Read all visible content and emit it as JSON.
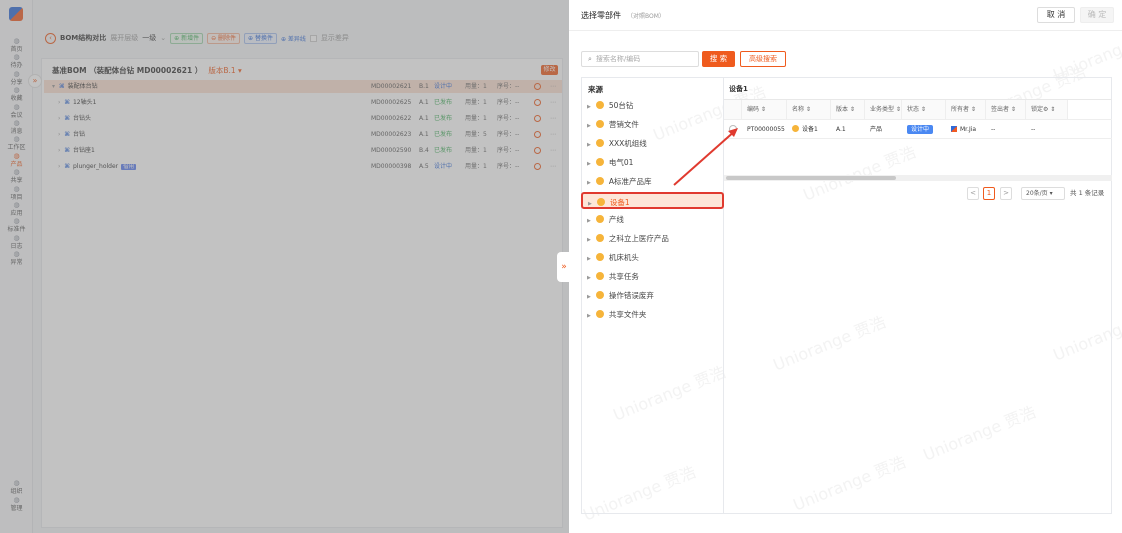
{
  "rail": {
    "items": [
      {
        "icon": "home-icon",
        "label": "首页"
      },
      {
        "icon": "todo-icon",
        "label": "待办"
      },
      {
        "icon": "share-icon",
        "label": "分享"
      },
      {
        "icon": "star-icon",
        "label": "收藏"
      },
      {
        "icon": "meeting-icon",
        "label": "会议"
      },
      {
        "icon": "message-icon",
        "label": "消息"
      },
      {
        "icon": "workspace-icon",
        "label": "工作区"
      },
      {
        "icon": "product-icon",
        "label": "产品"
      },
      {
        "icon": "shared-icon",
        "label": "共享"
      },
      {
        "icon": "project-icon",
        "label": "项目"
      },
      {
        "icon": "app-icon",
        "label": "应用"
      },
      {
        "icon": "standard-part-icon",
        "label": "标准件"
      },
      {
        "icon": "log-icon",
        "label": "日志"
      },
      {
        "icon": "exception-icon",
        "label": "异常"
      }
    ],
    "bottom": [
      {
        "icon": "org-icon",
        "label": "组织"
      },
      {
        "icon": "manage-icon",
        "label": "管理"
      }
    ],
    "collapse_glyph": "»"
  },
  "toolbar": {
    "title": "BOM结构对比",
    "expand_label": "展开层级",
    "level": "一级",
    "new_part": "⊕ 新增件",
    "delete_part": "⊖ 删除件",
    "replace_part": "⊕ 替换件",
    "diff_line": "⊕ 差异线",
    "show_diff": "显示差异"
  },
  "bom": {
    "title": "基准BOM （装配体台钻 MD00002621 ）",
    "version_label": "版本B.1 ▾",
    "edit_label": "修改",
    "rows": [
      {
        "name": "装配体台钻",
        "code": "MD00002621",
        "ver": "B.1",
        "status": "设计中",
        "status_kind": "design",
        "qty": "用量：1",
        "seq": "序号：--",
        "root": true,
        "tag": ""
      },
      {
        "name": "12轴头1",
        "code": "MD00002625",
        "ver": "A.1",
        "status": "已发布",
        "status_kind": "pub",
        "qty": "用量：1",
        "seq": "序号：--",
        "root": false,
        "tag": ""
      },
      {
        "name": "台钻头",
        "code": "MD00002622",
        "ver": "A.1",
        "status": "已发布",
        "status_kind": "pub",
        "qty": "用量：1",
        "seq": "序号：--",
        "root": false,
        "tag": ""
      },
      {
        "name": "台钻",
        "code": "MD00002623",
        "ver": "A.1",
        "status": "已发布",
        "status_kind": "pub",
        "qty": "用量：5",
        "seq": "序号：--",
        "root": false,
        "tag": ""
      },
      {
        "name": "台钻座1",
        "code": "MD00002590",
        "ver": "B.4",
        "status": "已发布",
        "status_kind": "pub",
        "qty": "用量：1",
        "seq": "序号：--",
        "root": false,
        "tag": ""
      },
      {
        "name": "plunger_holder",
        "code": "MD00000398",
        "ver": "A.5",
        "status": "设计中",
        "status_kind": "design",
        "qty": "用量：1",
        "seq": "序号：--",
        "root": false,
        "tag": "借用"
      }
    ]
  },
  "drawer": {
    "title": "选择零部件",
    "subtitle": "（对照BOM）",
    "cancel_label": "取 消",
    "ok_label": "确 定",
    "expand_glyph": "»",
    "search_placeholder": "搜索名称/编码",
    "search_label": "搜 索",
    "advanced_label": "高级搜索",
    "source_title": "来源",
    "sources": [
      "50台钻",
      "营销文件",
      "XXX机组线",
      "电气01",
      "A标准产品库",
      "设备1",
      "产线",
      "之科立上医疗产品",
      "机床机头",
      "共享任务",
      "操作错误废弃",
      "共享文件夹"
    ],
    "selected_source": "设备1",
    "grid_title": "设备1",
    "columns": [
      "编码 ⇕",
      "名称 ⇕",
      "版本 ⇕",
      "业务类型 ⇕",
      "状态 ⇕",
      "所有者 ⇕",
      "签出者 ⇕",
      "锁定⚙ ⇕"
    ],
    "rows": [
      {
        "code": "PT00000055",
        "name": "设备1",
        "version": "A.1",
        "type": "产品",
        "status": "设计中",
        "owner": "Mr.Jia",
        "checkout": "--",
        "lock": "--"
      }
    ],
    "pager": {
      "prev": "<",
      "current": "1",
      "next": ">",
      "size": "20条/页 ▾",
      "total": "共 1 条记录"
    },
    "watermark": "Uniorange 贾浩"
  },
  "colors": {
    "accent": "#ef5b1e",
    "blue": "#2f6ad8",
    "green": "#42b05c",
    "highlight": "#e03a2f"
  }
}
